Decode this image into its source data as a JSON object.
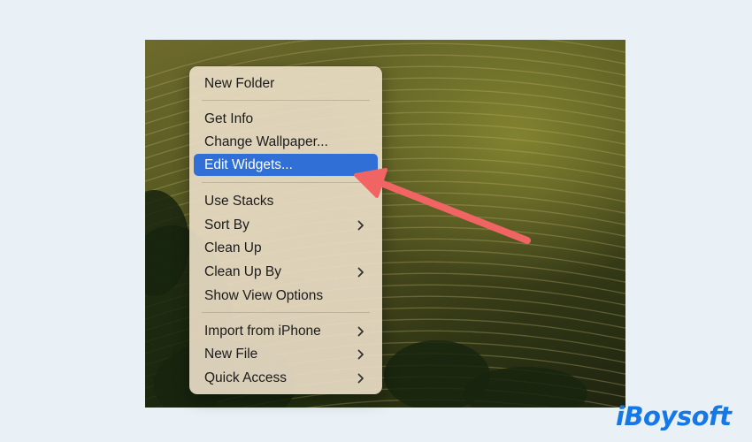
{
  "menu": {
    "items": [
      {
        "label": "New Folder",
        "submenu": false,
        "active": false
      },
      {
        "label": "Get Info",
        "submenu": false,
        "active": false
      },
      {
        "label": "Change Wallpaper...",
        "submenu": false,
        "active": false
      },
      {
        "label": "Edit Widgets...",
        "submenu": false,
        "active": true
      },
      {
        "label": "Use Stacks",
        "submenu": false,
        "active": false
      },
      {
        "label": "Sort By",
        "submenu": true,
        "active": false
      },
      {
        "label": "Clean Up",
        "submenu": false,
        "active": false
      },
      {
        "label": "Clean Up By",
        "submenu": true,
        "active": false
      },
      {
        "label": "Show View Options",
        "submenu": false,
        "active": false
      },
      {
        "label": "Import from iPhone",
        "submenu": true,
        "active": false
      },
      {
        "label": "New File",
        "submenu": true,
        "active": false
      },
      {
        "label": "Quick Access",
        "submenu": true,
        "active": false
      }
    ]
  },
  "colors": {
    "page_background": "#e9f1f7",
    "highlight": "#2f6fd6",
    "annotation_arrow": "#f06464",
    "brand": "#1578e6"
  },
  "annotation": {
    "icon": "pointer-arrow-icon"
  },
  "watermark": {
    "text": "iBoysoft"
  }
}
